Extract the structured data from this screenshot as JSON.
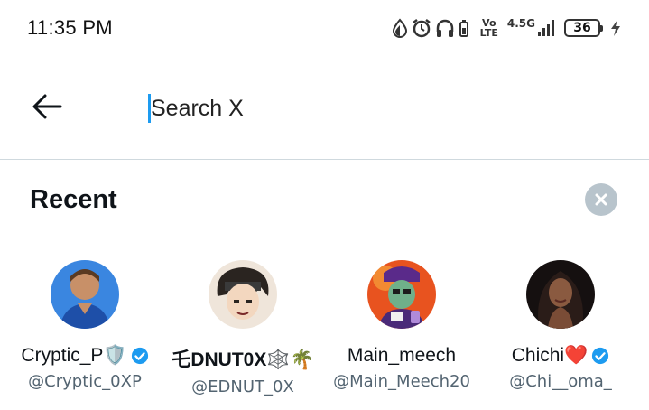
{
  "status_bar": {
    "time": "11:35 PM",
    "network_top": "Vo",
    "network_bottom": "LTE",
    "signal_label": "4.5G",
    "battery": "36",
    "icons": [
      "data-saver-icon",
      "alarm-icon",
      "headphones-icon",
      "battery-saver-icon",
      "volte-icon",
      "signal-icon",
      "battery-icon",
      "charging-icon"
    ]
  },
  "search": {
    "placeholder": "Search X",
    "value": ""
  },
  "recent": {
    "title": "Recent",
    "users": [
      {
        "display_name": "Cryptic_P🛡️",
        "handle": "@Cryptic_0XP",
        "verified": true,
        "bold": false,
        "avatar_color": "#2f6fd0"
      },
      {
        "display_name": "乇DNUT0X🕸️🌴",
        "handle": "@EDNUT_0X",
        "verified": false,
        "bold": true,
        "avatar_color": "#f0e6dc"
      },
      {
        "display_name": "Main_meech",
        "handle": "@Main_Meech20",
        "verified": false,
        "bold": false,
        "avatar_color": "#e8531f"
      },
      {
        "display_name": "Chichi❤️",
        "handle": "@Chi__oma_",
        "verified": true,
        "bold": false,
        "avatar_color": "#1a1412"
      }
    ]
  },
  "colors": {
    "accent": "#1d9bf0",
    "text": "#0f1419",
    "secondary_text": "#536471",
    "divider": "#cfd9de",
    "clear_button": "#b8c4cc"
  }
}
